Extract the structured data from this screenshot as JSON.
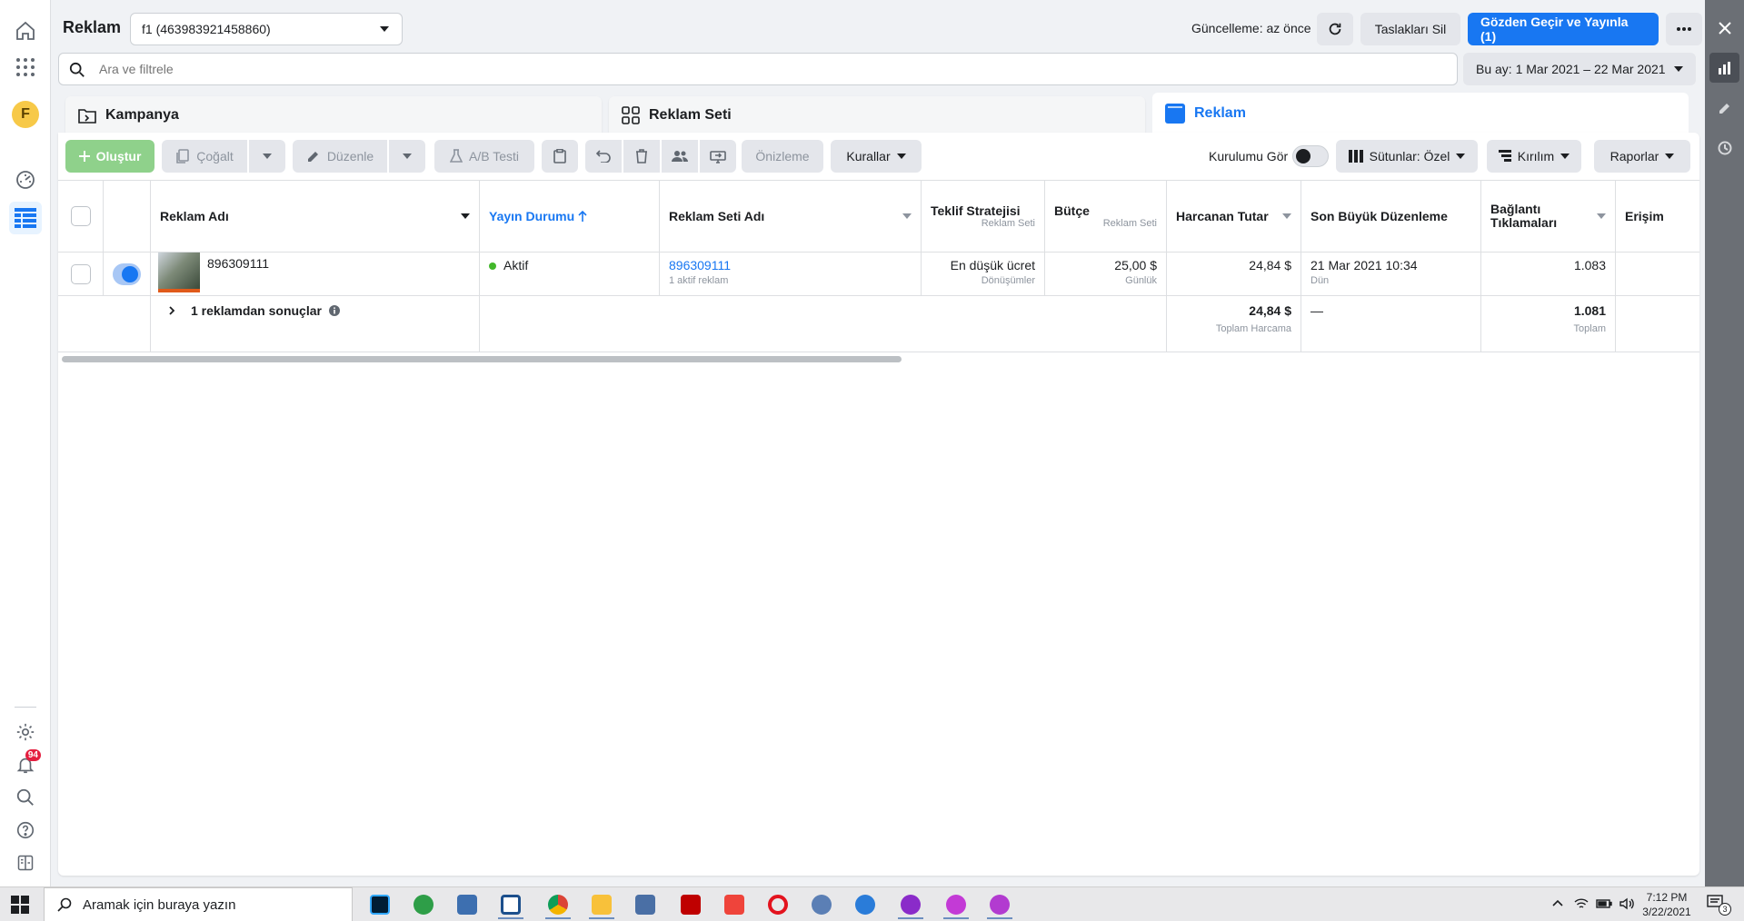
{
  "top_bar": {
    "title": "Reklam",
    "account_selector": "f1 (463983921458860)",
    "update_status": "Güncelleme: az önce",
    "discard_drafts": "Taslakları Sil",
    "review_publish": "Gözden Geçir ve Yayınla (1)"
  },
  "search": {
    "placeholder": "Ara ve filtrele",
    "date_range": "Bu ay: 1 Mar 2021 – 22 Mar 2021"
  },
  "level_tabs": {
    "campaign": "Kampanya",
    "adset": "Reklam Seti",
    "ad": "Reklam"
  },
  "toolbar": {
    "create": "Oluştur",
    "duplicate": "Çoğalt",
    "edit": "Düzenle",
    "ab_test": "A/B Testi",
    "preview": "Önizleme",
    "rules": "Kurallar",
    "view_setup": "Kurulumu Gör",
    "columns": "Sütunlar: Özel",
    "breakdown": "Kırılım",
    "reports": "Raporlar"
  },
  "table": {
    "headers": {
      "ad_name": "Reklam Adı",
      "delivery": "Yayın Durumu",
      "adset_name": "Reklam Seti Adı",
      "bid_strategy": "Teklif Stratejisi",
      "bid_strategy_sub": "Reklam Seti",
      "budget": "Bütçe",
      "budget_sub": "Reklam Seti",
      "amount_spent": "Harcanan Tutar",
      "last_edit": "Son Büyük Düzenleme",
      "link_clicks_1": "Bağlantı",
      "link_clicks_2": "Tıklamaları",
      "reach": "Erişim"
    },
    "row": {
      "ad_name": "896309111",
      "status": "Aktif",
      "adset_name": "896309111",
      "adset_sub": "1 aktif reklam",
      "bid_strategy": "En düşük ücret",
      "bid_strategy_sub": "Dönüşümler",
      "budget": "25,00 $",
      "budget_sub": "Günlük",
      "amount_spent": "24,84 $",
      "last_edit": "21 Mar 2021 10:34",
      "last_edit_sub": "Dün",
      "link_clicks": "1.083"
    },
    "summary": {
      "label": "1 reklamdan sonuçlar",
      "amount_spent": "24,84 $",
      "amount_spent_sub": "Toplam Harcama",
      "last_edit": "—",
      "link_clicks": "1.081",
      "link_clicks_sub": "Toplam"
    }
  },
  "left_rail": {
    "avatar_letter": "F",
    "notification_count": "94"
  },
  "taskbar": {
    "search_placeholder": "Aramak için buraya yazın",
    "time": "7:12 PM",
    "date": "3/22/2021",
    "notification_count": "3"
  },
  "colors": {
    "primary": "#1877f2",
    "create_green": "#8fd18b",
    "active_dot": "#42b72a"
  }
}
